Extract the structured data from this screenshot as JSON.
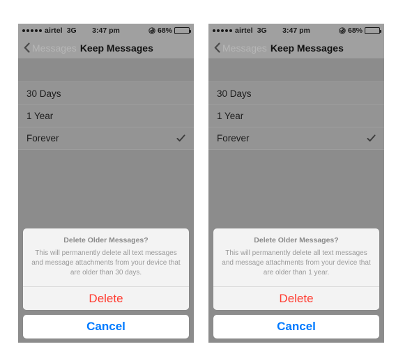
{
  "statusbar": {
    "signal_dots": 5,
    "carrier": "airtel",
    "network": "3G",
    "time": "3:47 pm",
    "battery_percent": "68%",
    "battery_level": 68,
    "rotation_lock_icon": "rotation-lock-icon",
    "battery_icon": "battery-icon"
  },
  "navbar": {
    "back_icon": "chevron-left-icon",
    "back_label": "Messages",
    "title": "Keep Messages"
  },
  "list": {
    "rows": [
      {
        "label": "30 Days",
        "checked": false
      },
      {
        "label": "1 Year",
        "checked": false
      },
      {
        "label": "Forever",
        "checked": true
      }
    ],
    "check_icon": "checkmark-icon"
  },
  "panels": [
    {
      "name": "left-panel",
      "alert": {
        "title": "Delete Older Messages?",
        "message": "This will permanently delete all text messages and message attachments from your device that are older than 30 days.",
        "destructive_label": "Delete",
        "cancel_label": "Cancel"
      }
    },
    {
      "name": "right-panel",
      "alert": {
        "title": "Delete Older Messages?",
        "message": "This will permanently delete all text messages and message attachments from your device that are older than 1 year.",
        "destructive_label": "Delete",
        "cancel_label": "Cancel"
      }
    }
  ],
  "colors": {
    "destructive": "#ff3b30",
    "tint": "#007aff",
    "screen_background": "#8c8c8c",
    "bar_background": "#a0a0a0",
    "list_background": "#949494",
    "alert_background": "#f3f3f3"
  }
}
